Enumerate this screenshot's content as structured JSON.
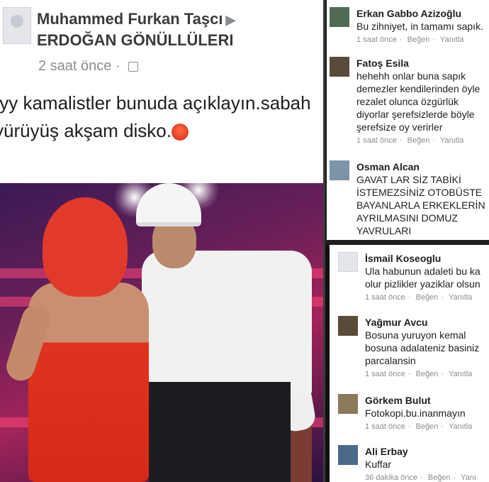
{
  "post": {
    "author": "Muhammed Furkan Taşcı",
    "group": "ERDOĞAN GÖNÜLLÜLERI",
    "time": "2 saat önce",
    "text": "ıyy kamalistler bunuda açıklayın.sabah yürüyüş akşam disko.",
    "arrow_icon": "triangle-right-icon",
    "privacy_icon": "globe-icon",
    "emoji": "angry-face-icon"
  },
  "comments_top": [
    {
      "name": "Erkan Gabbo Azizoğlu",
      "text": "Bu zihniyet, in tamamı sapık.",
      "time": "1 saat önce",
      "like": "Beğen",
      "reply": "Yanıtla"
    },
    {
      "name": "Fatoş Esila",
      "text": "hehehh onlar buna sapık\ndemezler kendilerinden öyle\nrezalet olunca özgürlük\ndiyorlar şerefsizlerde böyle\nşerefsize oy verirler",
      "time": "1 saat önce",
      "like": "Beğen",
      "reply": "Yanıtla"
    },
    {
      "name": "Osman Alcan",
      "text": "GAVAT LAR SİZ TABİKİ\nİSTEMEZSİNİZ OTOBÜSTE\nBAYANLARLA ERKEKLERİN\nAYRILMASINI DOMUZ\nYAVRULARI",
      "time": "",
      "like": "",
      "reply": ""
    }
  ],
  "comments_bottom": [
    {
      "name": "İsmail Koseoglu",
      "text": "Ula habunun adaleti bu ka\nolur pizlikler yaziklar olsun",
      "time": "1 saat önce",
      "like": "Beğen",
      "reply": "Yanıtla"
    },
    {
      "name": "Yağmur Avcu",
      "text": "Bosuna yuruyon kemal\nbosuna adalateniz basiniz\nparcalansin",
      "time": "1 saat önce",
      "like": "Beğen",
      "reply": "Yanıtla"
    },
    {
      "name": "Görkem Bulut",
      "text": "Fotokopi.bu.inanmayın",
      "time": "1 saat önce",
      "like": "Beğen",
      "reply": "Yanıtla"
    },
    {
      "name": "Ali Erbay",
      "text": "Kuffar",
      "time": "36 dakika önce",
      "like": "Beğen",
      "reply": "Yanı"
    }
  ]
}
